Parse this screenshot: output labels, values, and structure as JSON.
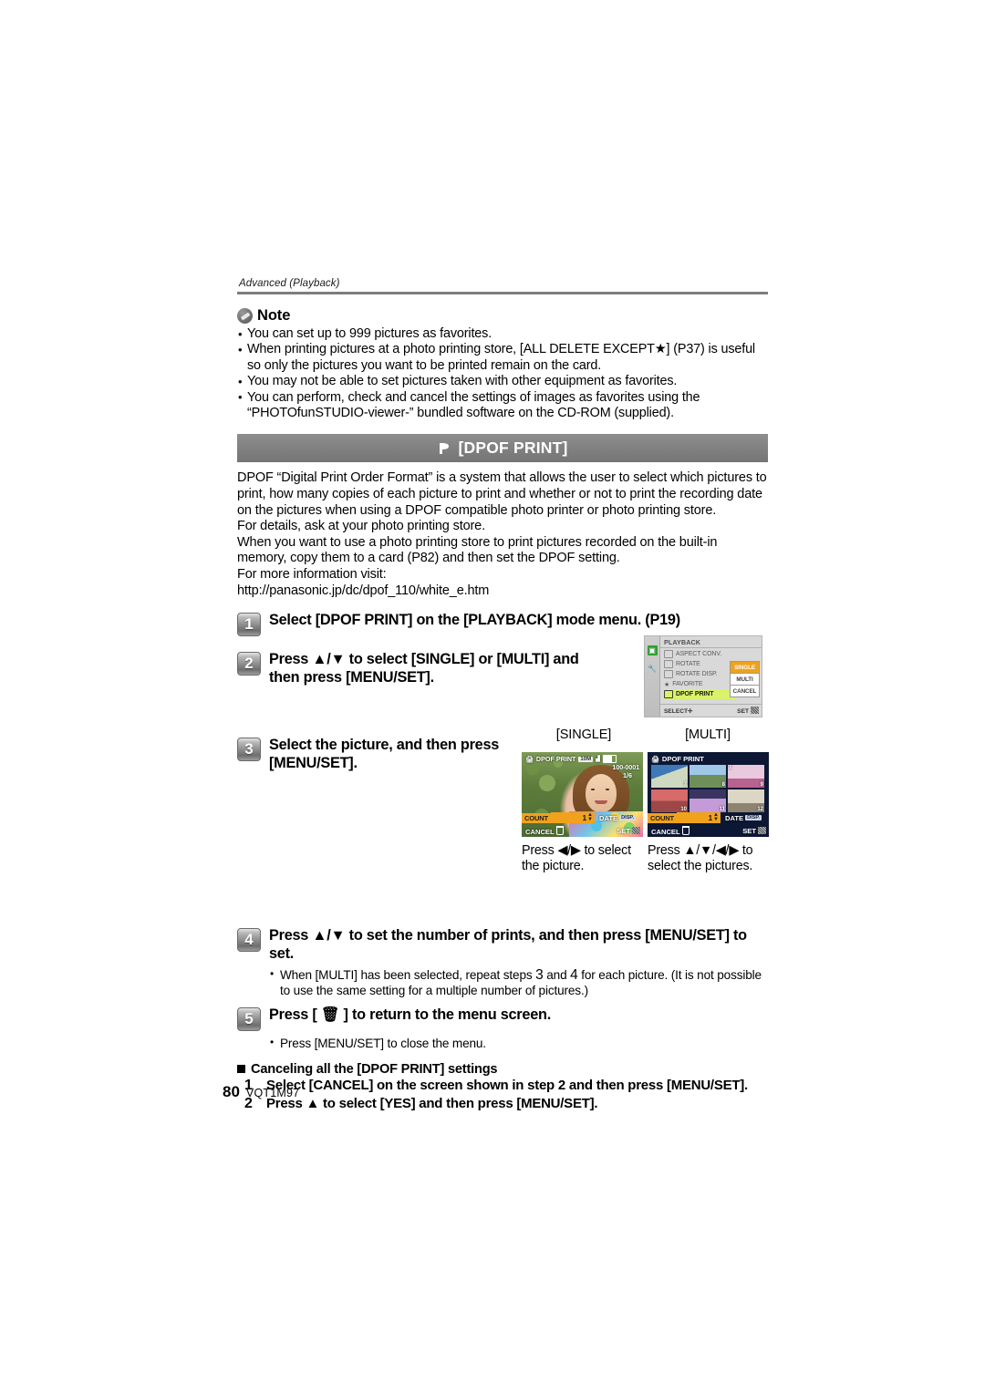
{
  "running_head": "Advanced (Playback)",
  "note": {
    "title": "Note",
    "icon": "pencil-note-icon",
    "bullets": [
      "You can set up to 999 pictures as favorites.",
      "When printing pictures at a photo printing store, [ALL DELETE EXCEPT★] (P37) is useful so only the pictures you want to be printed remain on the card.",
      "You may not be able to set pictures taken with other equipment as favorites.",
      "You can perform, check and cancel the settings of images as favorites using the “PHOTOfunSTUDIO-viewer-” bundled software on the CD-ROM (supplied)."
    ]
  },
  "section": {
    "icon": "dpof-flag-icon",
    "title": "[DPOF PRINT]",
    "bar_color": "#828282",
    "paragraphs": [
      "DPOF “Digital Print Order Format” is a system that allows the user to select which pictures to print, how many copies of each picture to print and whether or not to print the recording date on the pictures when using a DPOF compatible photo printer or photo printing store.",
      "For details, ask at your photo printing store.",
      "When you want to use a photo printing store to print pictures recorded on the built-in memory, copy them to a card (P82) and then set the DPOF setting.",
      "For more information visit:",
      "http://panasonic.jp/dc/dpof_110/white_e.htm"
    ]
  },
  "steps": [
    {
      "number": "1",
      "text": "Select [DPOF PRINT] on the [PLAYBACK] mode menu. (P19)"
    },
    {
      "number": "2",
      "text": "Press ▲/▼ to select [SINGLE] or [MULTI] and then press [MENU/SET]."
    },
    {
      "number": "3",
      "text": "Select the picture, and then press [MENU/SET]."
    },
    {
      "number": "4",
      "text": "Press ▲/▼ to set the number of prints, and then press [MENU/SET] to set."
    },
    {
      "number": "5",
      "text": "Press [ 🗑 ] to return to the menu screen."
    }
  ],
  "step4_bullet_parts": {
    "a": "When [MULTI] has been selected, repeat steps ",
    "n1": "3",
    "b": " and ",
    "n2": "4",
    "c": " for each picture. (It is not possible to use the same setting for a multiple number of pictures.)"
  },
  "step5_bullet": "Press [MENU/SET] to close the menu.",
  "menu_screen": {
    "title": "PLAYBACK",
    "items": [
      {
        "label": "ASPECT CONV.",
        "selected": false
      },
      {
        "label": "ROTATE",
        "selected": false
      },
      {
        "label": "ROTATE DISP.",
        "selected": false
      },
      {
        "label": "FAVORITE",
        "selected": false
      },
      {
        "label": "DPOF PRINT",
        "selected": true
      }
    ],
    "submenu": [
      {
        "label": "SINGLE",
        "highlighted": true
      },
      {
        "label": "MULTI",
        "highlighted": false
      },
      {
        "label": "CANCEL",
        "highlighted": false
      }
    ],
    "footer_left": "SELECT",
    "footer_right": "SET",
    "highlight_color": "#f0a21c",
    "selected_row_color": "#d9f26b"
  },
  "shot_labels": {
    "single": "[SINGLE]",
    "multi": "[MULTI]"
  },
  "single_screen": {
    "title": "DPOF PRINT",
    "pixel_badge": "10M",
    "file_no": "100-0001",
    "frame_no": "1/6",
    "count_label": "COUNT",
    "count_value": "1",
    "date_label": "DATE",
    "date_value": "DISP.",
    "cancel_label": "CANCEL",
    "set_label": "SET"
  },
  "multi_screen": {
    "title": "DPOF PRINT",
    "thumbnails": [
      {
        "number": "7",
        "dpof": ""
      },
      {
        "number": "8",
        "dpof": ""
      },
      {
        "number": "9",
        "dpof": "1"
      },
      {
        "number": "10",
        "dpof": ""
      },
      {
        "number": "11",
        "dpof": ""
      },
      {
        "number": "12",
        "dpof": ""
      }
    ],
    "count_label": "COUNT",
    "count_value": "1",
    "date_label": "DATE",
    "date_value": "DISP.",
    "cancel_label": "CANCEL",
    "set_label": "SET"
  },
  "shot_captions": {
    "single": "Press ◀/▶ to select the picture.",
    "multi": "Press ▲/▼/◀/▶ to select the pictures."
  },
  "cancel_section": {
    "heading": "Canceling all the [DPOF PRINT] settings",
    "items": [
      {
        "number": "1",
        "text": "Select [CANCEL] on the screen shown in step 2 and then press [MENU/SET]."
      },
      {
        "number": "2",
        "text": "Press ▲ to select [YES] and then press [MENU/SET]."
      }
    ]
  },
  "footer": {
    "page": "80",
    "code": "VQT1M97"
  }
}
